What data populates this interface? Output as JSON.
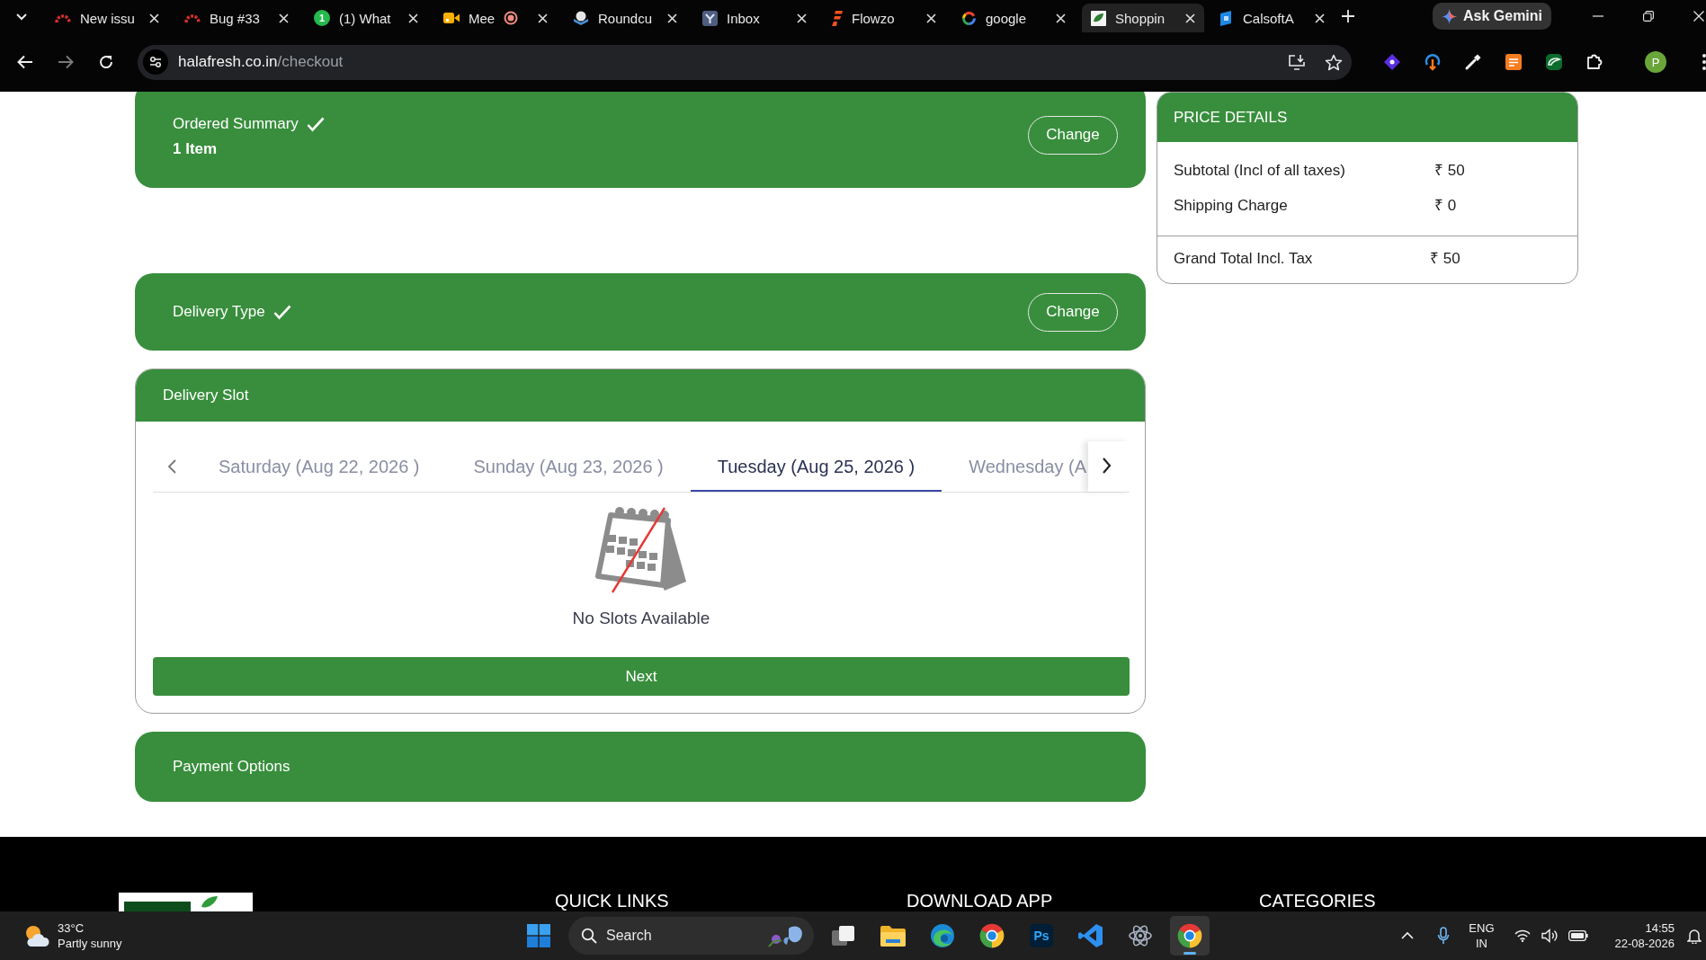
{
  "browser": {
    "tabs": [
      {
        "kind": "arc",
        "title": "New issu",
        "recording": false,
        "selected": false
      },
      {
        "kind": "arc",
        "title": "Bug #33",
        "recording": false,
        "selected": false
      },
      {
        "kind": "badge",
        "badge": "1",
        "title": "(1) What",
        "recording": false,
        "selected": false
      },
      {
        "kind": "camera",
        "title": "Mee",
        "recording": true,
        "selected": false
      },
      {
        "kind": "cloud",
        "title": "Roundcu",
        "recording": false,
        "selected": false
      },
      {
        "kind": "tile",
        "title": "Inbox",
        "recording": false,
        "selected": false
      },
      {
        "kind": "stripes",
        "title": "Flowzo",
        "recording": false,
        "selected": false
      },
      {
        "kind": "ring",
        "title": "google",
        "recording": false,
        "selected": false
      },
      {
        "kind": "leaf",
        "title": "Shoppin",
        "recording": false,
        "selected": true
      },
      {
        "kind": "square",
        "title": "CalsoftA",
        "recording": false,
        "selected": false
      }
    ],
    "assistant_button": "Ask Gemini",
    "url": {
      "host": "halafresh.co.in",
      "path": "/checkout"
    },
    "profile_initial": "P"
  },
  "checkout": {
    "steps": [
      {
        "kind": "summary",
        "title": "Ordered Summary",
        "completed": true,
        "detail": "1 Item",
        "action": "Change"
      },
      {
        "kind": "summary",
        "title": "Delivery Type",
        "completed": true,
        "action": "Change"
      },
      {
        "kind": "slots",
        "title": "Delivery Slot",
        "days": [
          {
            "label": "Saturday (Aug 22, 2026 )",
            "selected": false
          },
          {
            "label": "Sunday (Aug 23, 2026 )",
            "selected": false
          },
          {
            "label": "Tuesday (Aug 25, 2026 )",
            "selected": true
          },
          {
            "label": "Wednesday (A",
            "selected": false
          }
        ],
        "empty_message": "No Slots Available",
        "next_button": "Next"
      },
      {
        "kind": "collapsed",
        "title": "Payment Options"
      }
    ]
  },
  "price_details": {
    "title": "PRICE DETAILS",
    "rows": [
      {
        "label": "Subtotal (Incl of all taxes)",
        "value": "₹ 50"
      },
      {
        "label": "Shipping Charge",
        "value": "₹ 0"
      }
    ],
    "total": {
      "label": "Grand Total Incl. Tax",
      "value": "₹ 50"
    }
  },
  "footer": {
    "headings": [
      "QUICK LINKS",
      "DOWNLOAD APP",
      "CATEGORIES"
    ]
  },
  "taskbar": {
    "weather": {
      "temperature": "33°C",
      "condition": "Partly sunny"
    },
    "search": {
      "placeholder": "Search"
    },
    "apps": [
      {
        "kind": "task-view",
        "selected": false
      },
      {
        "kind": "folder",
        "selected": false
      },
      {
        "kind": "swirl",
        "selected": false
      },
      {
        "kind": "wheel",
        "selected": false
      },
      {
        "kind": "ps",
        "label": "Ps",
        "selected": false
      },
      {
        "kind": "ribbon",
        "selected": false
      },
      {
        "kind": "atom",
        "selected": false
      },
      {
        "kind": "wheel",
        "selected": true
      }
    ],
    "language": "ENG",
    "region": "IN",
    "time": "14:55",
    "date": "22-08-2026"
  }
}
